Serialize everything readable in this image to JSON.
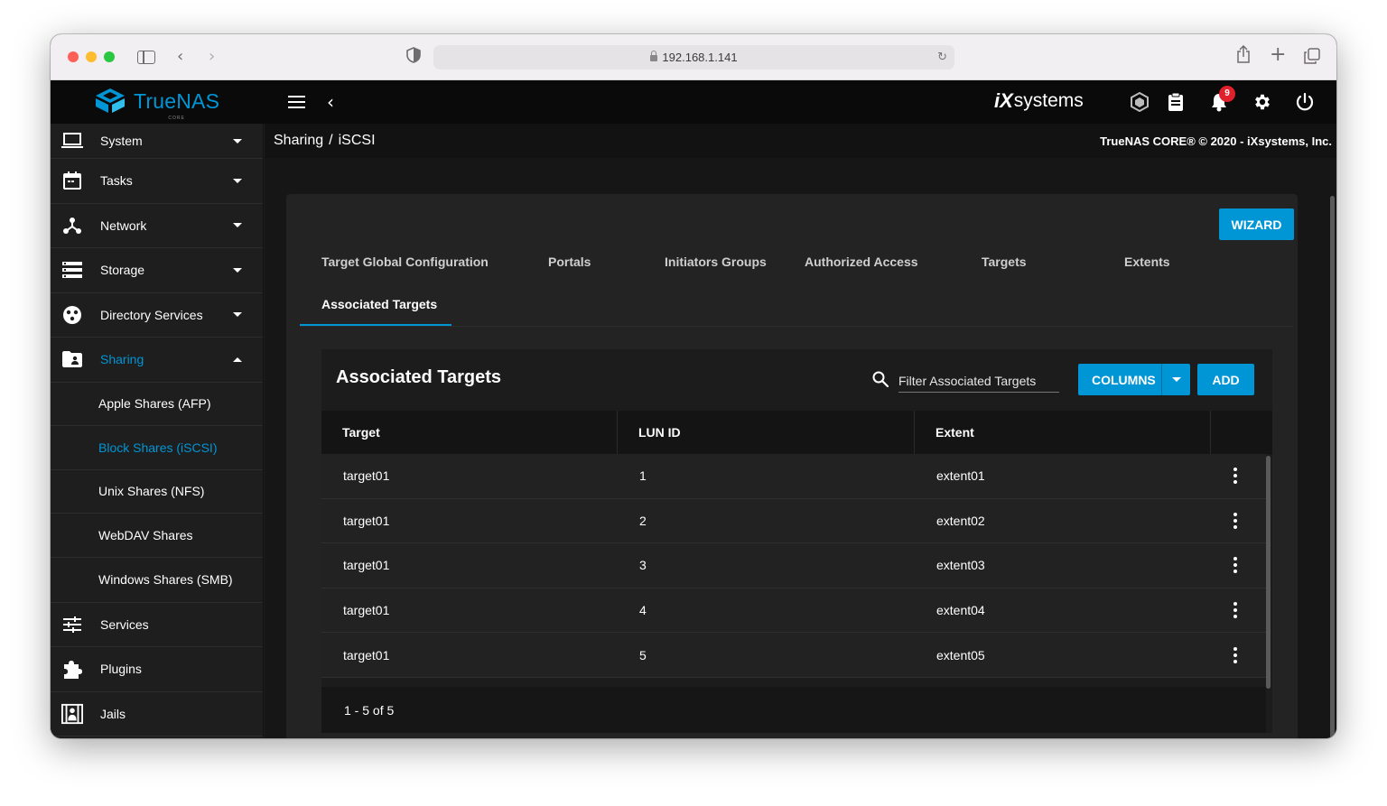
{
  "browser": {
    "url": "192.168.1.141"
  },
  "header": {
    "brand": "TrueNAS",
    "brand_sub": "CORE",
    "vendor": "systems",
    "vendor_prefix": "iX",
    "notification_count": "9"
  },
  "sidebar": {
    "items": [
      {
        "label": "System",
        "icon": "laptop-icon"
      },
      {
        "label": "Tasks",
        "icon": "calendar-icon"
      },
      {
        "label": "Network",
        "icon": "network-icon"
      },
      {
        "label": "Storage",
        "icon": "storage-icon"
      },
      {
        "label": "Directory Services",
        "icon": "directory-icon"
      },
      {
        "label": "Sharing",
        "icon": "folder-share-icon"
      }
    ],
    "sharing_sub": [
      {
        "label": "Apple Shares (AFP)"
      },
      {
        "label": "Block Shares (iSCSI)"
      },
      {
        "label": "Unix Shares (NFS)"
      },
      {
        "label": "WebDAV Shares"
      },
      {
        "label": "Windows Shares (SMB)"
      }
    ],
    "bottom_items": [
      {
        "label": "Services",
        "icon": "tune-icon"
      },
      {
        "label": "Plugins",
        "icon": "puzzle-icon"
      },
      {
        "label": "Jails",
        "icon": "jail-icon"
      }
    ]
  },
  "breadcrumb": {
    "parent": "Sharing",
    "separator": "/",
    "current": "iSCSI"
  },
  "copyright": "TrueNAS CORE® © 2020 - iXsystems, Inc.",
  "wizard_label": "WIZARD",
  "tabs": [
    {
      "label": "Target Global Configuration"
    },
    {
      "label": "Portals"
    },
    {
      "label": "Initiators Groups"
    },
    {
      "label": "Authorized Access"
    },
    {
      "label": "Targets"
    },
    {
      "label": "Extents"
    },
    {
      "label": "Associated Targets"
    }
  ],
  "table": {
    "title": "Associated Targets",
    "filter_placeholder": "Filter Associated Targets",
    "columns_label": "COLUMNS",
    "add_label": "ADD",
    "headers": [
      "Target",
      "LUN ID",
      "Extent"
    ],
    "rows": [
      {
        "target": "target01",
        "lun": "1",
        "extent": "extent01"
      },
      {
        "target": "target01",
        "lun": "2",
        "extent": "extent02"
      },
      {
        "target": "target01",
        "lun": "3",
        "extent": "extent03"
      },
      {
        "target": "target01",
        "lun": "4",
        "extent": "extent04"
      },
      {
        "target": "target01",
        "lun": "5",
        "extent": "extent05"
      }
    ],
    "pagination": "1 - 5 of 5"
  },
  "colors": {
    "accent": "#0095d5",
    "badge": "#e0202a"
  }
}
